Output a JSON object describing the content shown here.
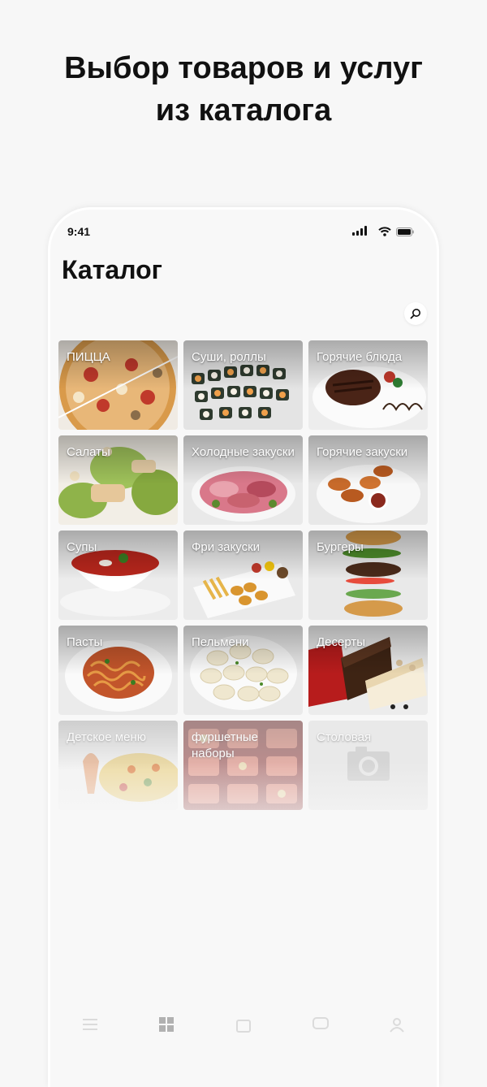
{
  "hero": {
    "line1": "Выбор товаров и услуг",
    "line2": "из каталога"
  },
  "status_bar": {
    "time": "9:41",
    "icons": [
      "cellular-signal-icon",
      "wifi-icon",
      "battery-icon"
    ]
  },
  "page": {
    "title": "Каталог",
    "search_icon": "search-icon"
  },
  "catalog": [
    {
      "label": "ПИЦЦА"
    },
    {
      "label": "Суши, роллы"
    },
    {
      "label": "Горячие блюда"
    },
    {
      "label": "Салаты"
    },
    {
      "label": "Холодные закуски"
    },
    {
      "label": "Горячие закуски"
    },
    {
      "label": "Супы"
    },
    {
      "label": "Фри закуски"
    },
    {
      "label": "Бургеры"
    },
    {
      "label": "Пасты"
    },
    {
      "label": "Пельмени"
    },
    {
      "label": "Десерты"
    },
    {
      "label": "Детское меню"
    },
    {
      "label": "фуршетные наборы"
    },
    {
      "label": "Столовая"
    }
  ],
  "tab_bar": {
    "icons": [
      "list-icon",
      "grid-icon",
      "bag-icon",
      "chat-icon",
      "profile-icon"
    ]
  },
  "colors": {
    "background": "#f7f7f7",
    "text": "#111111",
    "tile_placeholder": "#e3e3e3"
  }
}
